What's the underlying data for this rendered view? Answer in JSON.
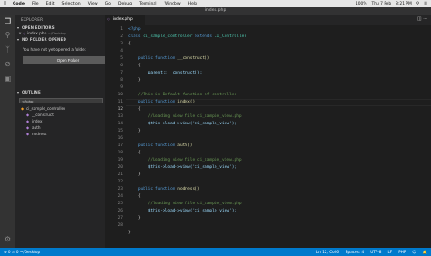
{
  "menubar": {
    "apple": "",
    "items": [
      "Code",
      "File",
      "Edit",
      "Selection",
      "View",
      "Go",
      "Debug",
      "Terminal",
      "Window",
      "Help"
    ],
    "status_right": [
      "100%",
      "Thu 7 Feb",
      "8:21 PM"
    ]
  },
  "window": {
    "title": "index.php"
  },
  "sidebar": {
    "title": "EXPLORER",
    "open_editors": {
      "header": "OPEN EDITORS",
      "file": "index.php",
      "path": "~/Desktop"
    },
    "no_folder": {
      "header": "NO FOLDER OPENED",
      "message": "You have not yet opened a folder.",
      "button": "Open Folder"
    },
    "outline": {
      "header": "OUTLINE",
      "filter": "<?php",
      "class_name": "ci_sample_controller",
      "members": [
        "__construct",
        "index",
        "auth",
        "nodress"
      ]
    }
  },
  "editor": {
    "tab_label": "index.php",
    "actions": "◫ ···",
    "active_line": 12,
    "line_numbers": [
      "1",
      "2",
      "3",
      "4",
      "5",
      "6",
      "7",
      "8",
      "9",
      "10",
      "11",
      "12",
      "13",
      "14",
      "15",
      "16",
      "17",
      "18",
      "19",
      "20",
      "21",
      "22",
      "23",
      "24",
      "25",
      "26",
      "27",
      "28"
    ],
    "code": {
      "l1_open": "<?php",
      "l2_kw": "class",
      "l2_name": "ci_sample_controller",
      "l2_extends": "extends",
      "l2_parent": "CI_Controller",
      "brace_open": "{",
      "brace_close": "}",
      "public": "public",
      "function": "function",
      "fn_construct": "__construct()",
      "parent_call": "parent::__construct();",
      "comment_default": "//This is Default function of controller",
      "fn_index": "index()",
      "comment_view_1": "//Loading view file ci_sample_view.php",
      "load_view_stmt": "$this->load->view('ci_sample_view');",
      "fn_auth": "auth()",
      "comment_view_2": "//Loading view file ci_sample_view.php",
      "fn_nodress": "nodress()",
      "comment_view_3": "//loading view file ci_sample_view.php"
    }
  },
  "statusbar": {
    "left": "⊗ 0 ⚠ 0  ~/Desktop",
    "position": "Ln 12, Col 6",
    "spaces": "Spaces: 4",
    "encoding": "UTF-8",
    "eol": "LF",
    "language": "PHP",
    "feedback": "☺",
    "notifications": "🔔"
  },
  "colors": {
    "statusbar": "#007acc",
    "editor_bg": "#1e1e1e",
    "sidebar_bg": "#252526",
    "activitybar_bg": "#333333"
  }
}
